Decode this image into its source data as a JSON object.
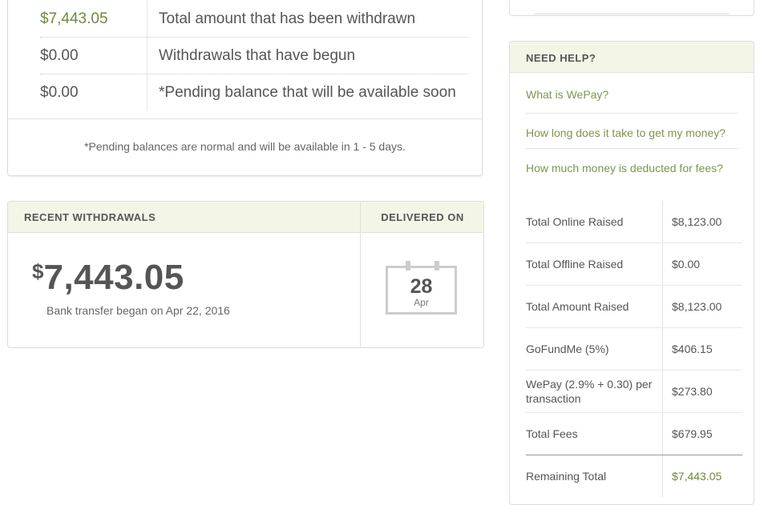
{
  "summary": {
    "rows": [
      {
        "amount": "$7,443.05",
        "description": "Total amount that has been withdrawn"
      },
      {
        "amount": "$0.00",
        "description": "Withdrawals that have begun"
      },
      {
        "amount": "$0.00",
        "description": "*Pending balance that will be available soon"
      }
    ],
    "footnote": "*Pending balances are normal and will be available in 1 - 5 days."
  },
  "withdrawals": {
    "header_title": "RECENT WITHDRAWALS",
    "header_delivered": "DELIVERED ON",
    "currency_symbol": "$",
    "amount": "7,443.05",
    "note": "Bank transfer began on Apr 22, 2016",
    "delivered_day": "28",
    "delivered_month": "Apr"
  },
  "help": {
    "title": "NEED HELP?",
    "links": [
      "What is WePay?",
      "How long does it take to get my money?",
      "How much money is deducted for fees?"
    ]
  },
  "fees": {
    "rows": [
      {
        "label": "Total Online Raised",
        "value": "$8,123.00"
      },
      {
        "label": "Total Offline Raised",
        "value": "$0.00"
      },
      {
        "label": "Total Amount Raised",
        "value": "$8,123.00"
      },
      {
        "label": "GoFundMe (5%)",
        "value": "$406.15"
      },
      {
        "label": "WePay (2.9% + 0.30) per transaction",
        "value": "$273.80"
      },
      {
        "label": "Total Fees",
        "value": "$679.95"
      },
      {
        "label": "Remaining Total",
        "value": "$7,443.05"
      }
    ]
  },
  "colors": {
    "accent_green": "#6d8b3a",
    "link_green": "#7d9550",
    "header_bg": "#f3f6e6"
  }
}
